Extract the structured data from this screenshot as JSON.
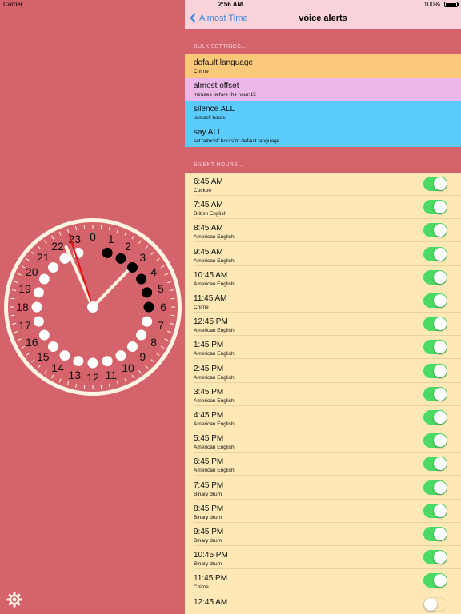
{
  "status_bar": {
    "carrier": "Carrier",
    "time": "2:56 AM",
    "battery": "100%"
  },
  "nav": {
    "back_label": "Almost Time",
    "title": "voice alerts"
  },
  "bulk_settings": {
    "header": "BULK SETTINGS...",
    "rows": [
      {
        "title": "default language",
        "subtitle": "Chime",
        "color": "#fcc97a"
      },
      {
        "title": "almost offset",
        "subtitle": "minutes before the hour:15",
        "color": "#ebb8e9"
      },
      {
        "title": "silence ALL",
        "subtitle": "'almost' hours",
        "color": "#5acbfa"
      },
      {
        "title": "say ALL",
        "subtitle": "set 'almost' hours to default language",
        "color": "#5acbfa"
      }
    ]
  },
  "silent_hours": {
    "header": "SILENT HOURS...",
    "rows": [
      {
        "time": "6:45 AM",
        "voice": "Cuckoo",
        "enabled": true
      },
      {
        "time": "7:45 AM",
        "voice": "British English",
        "enabled": true
      },
      {
        "time": "8:45 AM",
        "voice": "American English",
        "enabled": true
      },
      {
        "time": "9:45 AM",
        "voice": "American English",
        "enabled": true
      },
      {
        "time": "10:45 AM",
        "voice": "American English",
        "enabled": true
      },
      {
        "time": "11:45 AM",
        "voice": "Chime",
        "enabled": true
      },
      {
        "time": "12:45 PM",
        "voice": "American English",
        "enabled": true
      },
      {
        "time": "1:45 PM",
        "voice": "American English",
        "enabled": true
      },
      {
        "time": "2:45 PM",
        "voice": "American English",
        "enabled": true
      },
      {
        "time": "3:45 PM",
        "voice": "American English",
        "enabled": true
      },
      {
        "time": "4:45 PM",
        "voice": "American English",
        "enabled": true
      },
      {
        "time": "5:45 PM",
        "voice": "American English",
        "enabled": true
      },
      {
        "time": "6:45 PM",
        "voice": "American English",
        "enabled": true
      },
      {
        "time": "7:45 PM",
        "voice": "Binary drum",
        "enabled": true
      },
      {
        "time": "8:45 PM",
        "voice": "Binary drum",
        "enabled": true
      },
      {
        "time": "9:45 PM",
        "voice": "Binary drum",
        "enabled": true
      },
      {
        "time": "10:45 PM",
        "voice": "Binary drum",
        "enabled": true
      },
      {
        "time": "11:45 PM",
        "voice": "Chime",
        "enabled": true
      },
      {
        "time": "12:45 AM",
        "voice": "",
        "enabled": false
      }
    ]
  },
  "clock": {
    "numbers": [
      "0",
      "1",
      "2",
      "3",
      "4",
      "5",
      "6",
      "7",
      "8",
      "9",
      "10",
      "11",
      "12",
      "13",
      "14",
      "15",
      "16",
      "17",
      "18",
      "19",
      "20",
      "21",
      "22",
      "23"
    ],
    "hour": 2,
    "minute": 56,
    "second": 57,
    "dark_hour_dots": [
      1,
      2,
      3,
      4,
      5,
      6
    ],
    "face_color": "#fdf4e3",
    "background_color": "#d5636c",
    "hand_color": "#fdf4e3",
    "second_hand_color": "#e01010"
  },
  "settings_icon": "gear-icon"
}
